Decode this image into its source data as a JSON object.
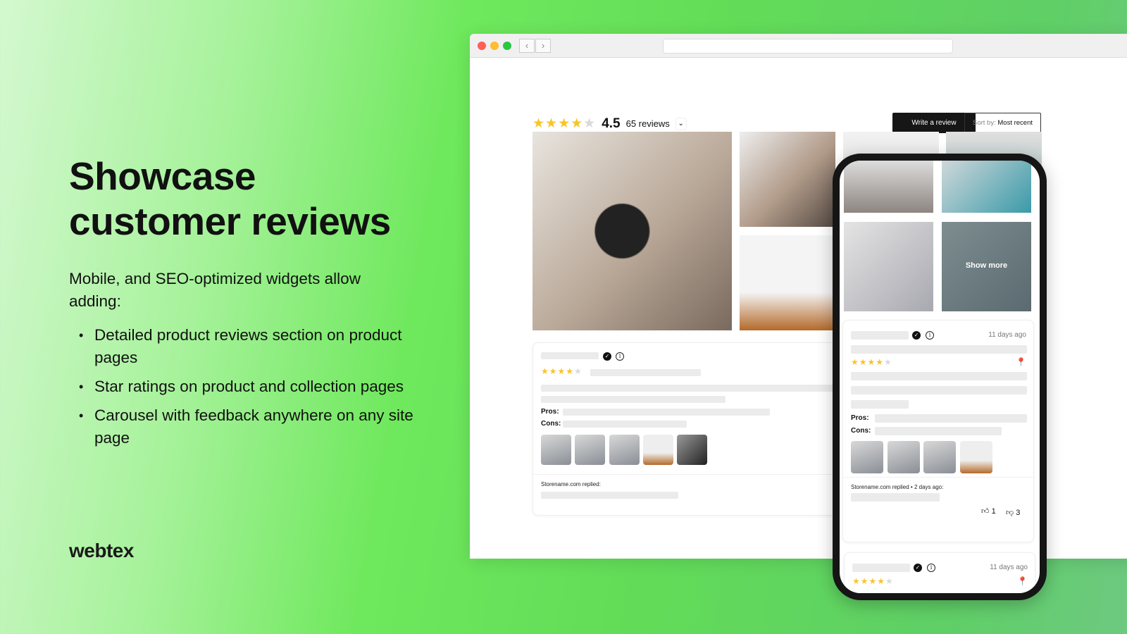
{
  "hero": {
    "title_line1": "Showcase",
    "title_line2": "customer reviews",
    "intro": "Mobile, and SEO-optimized widgets allow adding:",
    "bullets": [
      "Detailed product reviews section on product pages",
      "Star ratings on product and collection pages",
      "Carousel with feedback anywhere on any site page"
    ]
  },
  "brand": {
    "logo": "webtex"
  },
  "widget": {
    "rating": "4.5",
    "stars": 4,
    "review_count": "65 reviews",
    "write_review": "Write a review",
    "sort_prefix": "Sort by:",
    "sort_value": "Most recent",
    "show_more": "Show more"
  },
  "desktop_review": {
    "stars": 4,
    "pros_label": "Pros:",
    "cons_label": "Cons:",
    "reply": "Storename.com replied:"
  },
  "mobile_review": {
    "time": "11 days ago",
    "stars": 4,
    "pros_label": "Pros:",
    "cons_label": "Cons:",
    "reply": "Storename.com replied • 2 days ago:",
    "likes": "1",
    "dislikes": "3"
  },
  "mobile_review2": {
    "time": "11 days ago",
    "stars": 4
  },
  "colors": {
    "star": "#f7c52b",
    "button": "#161616"
  }
}
